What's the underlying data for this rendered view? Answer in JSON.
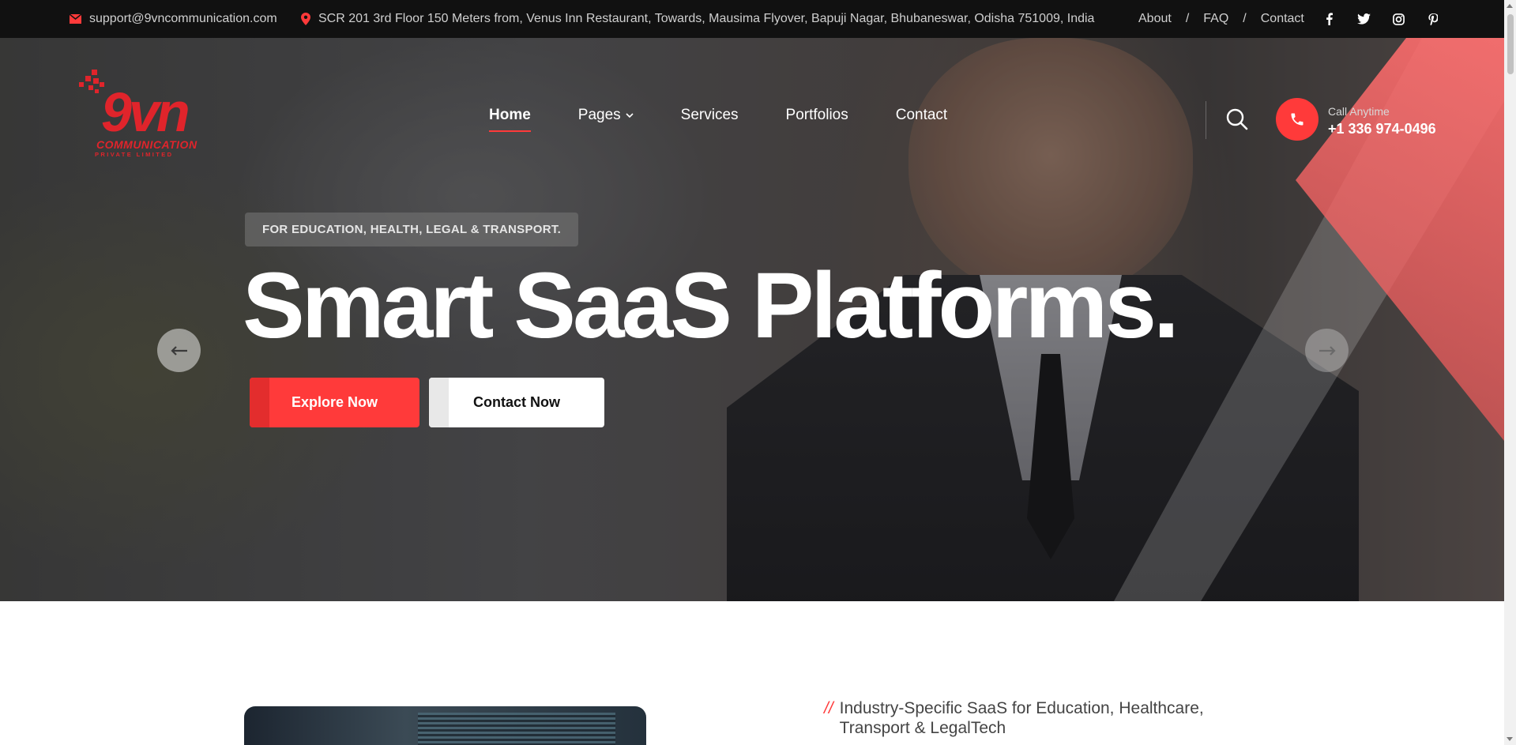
{
  "topbar": {
    "email": "support@9vncommunication.com",
    "address": "SCR 201 3rd Floor 150 Meters from, Venus Inn Restaurant, Towards, Mausima Flyover, Bapuji Nagar, Bhubaneswar, Odisha 751009, India",
    "links": [
      {
        "label": "About"
      },
      {
        "label": "FAQ"
      },
      {
        "label": "Contact"
      }
    ],
    "separator": "/",
    "socials": [
      "facebook-icon",
      "twitter-icon",
      "instagram-icon",
      "pinterest-icon"
    ]
  },
  "header": {
    "logo": {
      "brand": "9vn",
      "line1": "COMMUNICATION",
      "line2": "PRIVATE LIMITED"
    },
    "nav": [
      {
        "label": "Home",
        "active": true
      },
      {
        "label": "Pages",
        "dropdown": true
      },
      {
        "label": "Services"
      },
      {
        "label": "Portfolios"
      },
      {
        "label": "Contact"
      }
    ],
    "call_label": "Call Anytime",
    "call_number": "+1 336 974-0496"
  },
  "hero": {
    "tagline": "FOR EDUCATION, HEALTH, LEGAL & TRANSPORT.",
    "headline": "Smart SaaS Platforms.",
    "primary_button": "Explore Now",
    "secondary_button": "Contact Now"
  },
  "about": {
    "slashes": "//",
    "subtitle": "Industry-Specific SaaS for Education, Healthcare, Transport & LegalTech"
  },
  "colors": {
    "accent": "#ff3a3a",
    "topbar_bg": "#111111",
    "text_light": "#ffffff"
  }
}
